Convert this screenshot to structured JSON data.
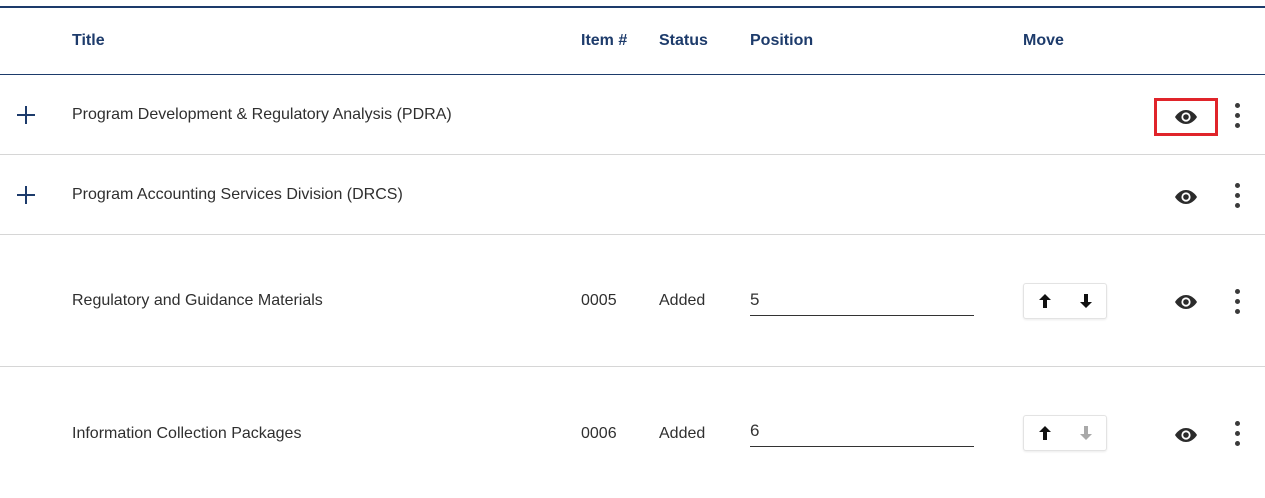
{
  "table": {
    "headers": {
      "title": "Title",
      "item": "Item #",
      "status": "Status",
      "position": "Position",
      "move": "Move"
    },
    "rows": [
      {
        "title": "Program Development & Regulatory Analysis (PDRA)",
        "expandable": true,
        "item": "",
        "status": "",
        "position": "",
        "eye_highlighted": true
      },
      {
        "title": "Program Accounting Services Division (DRCS)",
        "expandable": true,
        "item": "",
        "status": "",
        "position": ""
      },
      {
        "title": "Regulatory and Guidance Materials",
        "expandable": false,
        "item": "0005",
        "status": "Added",
        "position": "5",
        "move_down_enabled": true
      },
      {
        "title": "Information Collection Packages",
        "expandable": false,
        "item": "0006",
        "status": "Added",
        "position": "6",
        "move_down_enabled": false
      }
    ]
  },
  "icons": {
    "expand": "plus-icon",
    "up": "arrow-up-icon",
    "down": "arrow-down-icon",
    "view": "eye-icon",
    "more": "kebab-menu-icon"
  },
  "colors": {
    "header_text": "#1d3b6b",
    "highlight_box": "#e0242a",
    "disabled_arrow": "#a9a9a9"
  }
}
